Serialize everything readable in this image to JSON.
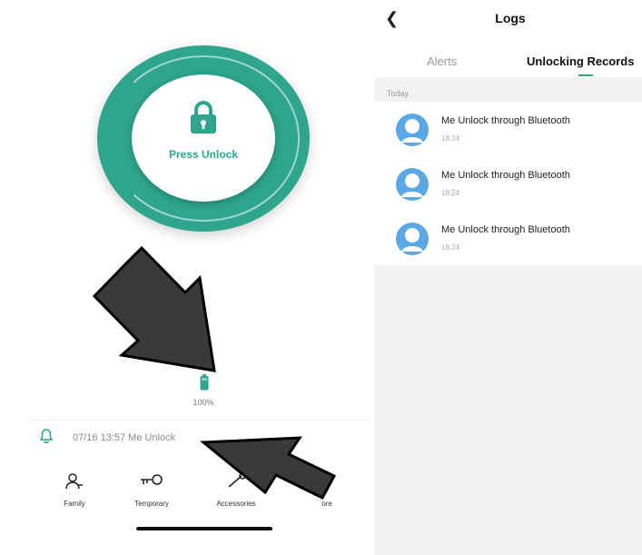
{
  "left": {
    "unlock_label": "Press Unlock",
    "battery_text": "100%",
    "notification_text": "07/16 13:57 Me Unlock",
    "nav": [
      {
        "label": "Family",
        "icon": "family-icon"
      },
      {
        "label": "Temporary",
        "icon": "key-icon"
      },
      {
        "label": "Accessories",
        "icon": "accessories-icon"
      },
      {
        "label": "ore",
        "icon": "more-icon"
      }
    ]
  },
  "right": {
    "title": "Logs",
    "tabs": [
      "Alerts",
      "Unlocking Records"
    ],
    "active_tab": "Unlocking Records",
    "section": "Today",
    "records": [
      {
        "title": "Me Unlock through Bluetooth",
        "time": "18:24"
      },
      {
        "title": "Me Unlock through Bluetooth",
        "time": "18:24"
      },
      {
        "title": "Me Unlock through Bluetooth",
        "time": "18:24"
      }
    ]
  },
  "colors": {
    "accent": "#2ea58c",
    "avatar": "#5aa9e6",
    "arrow": "#3a3a3a"
  }
}
